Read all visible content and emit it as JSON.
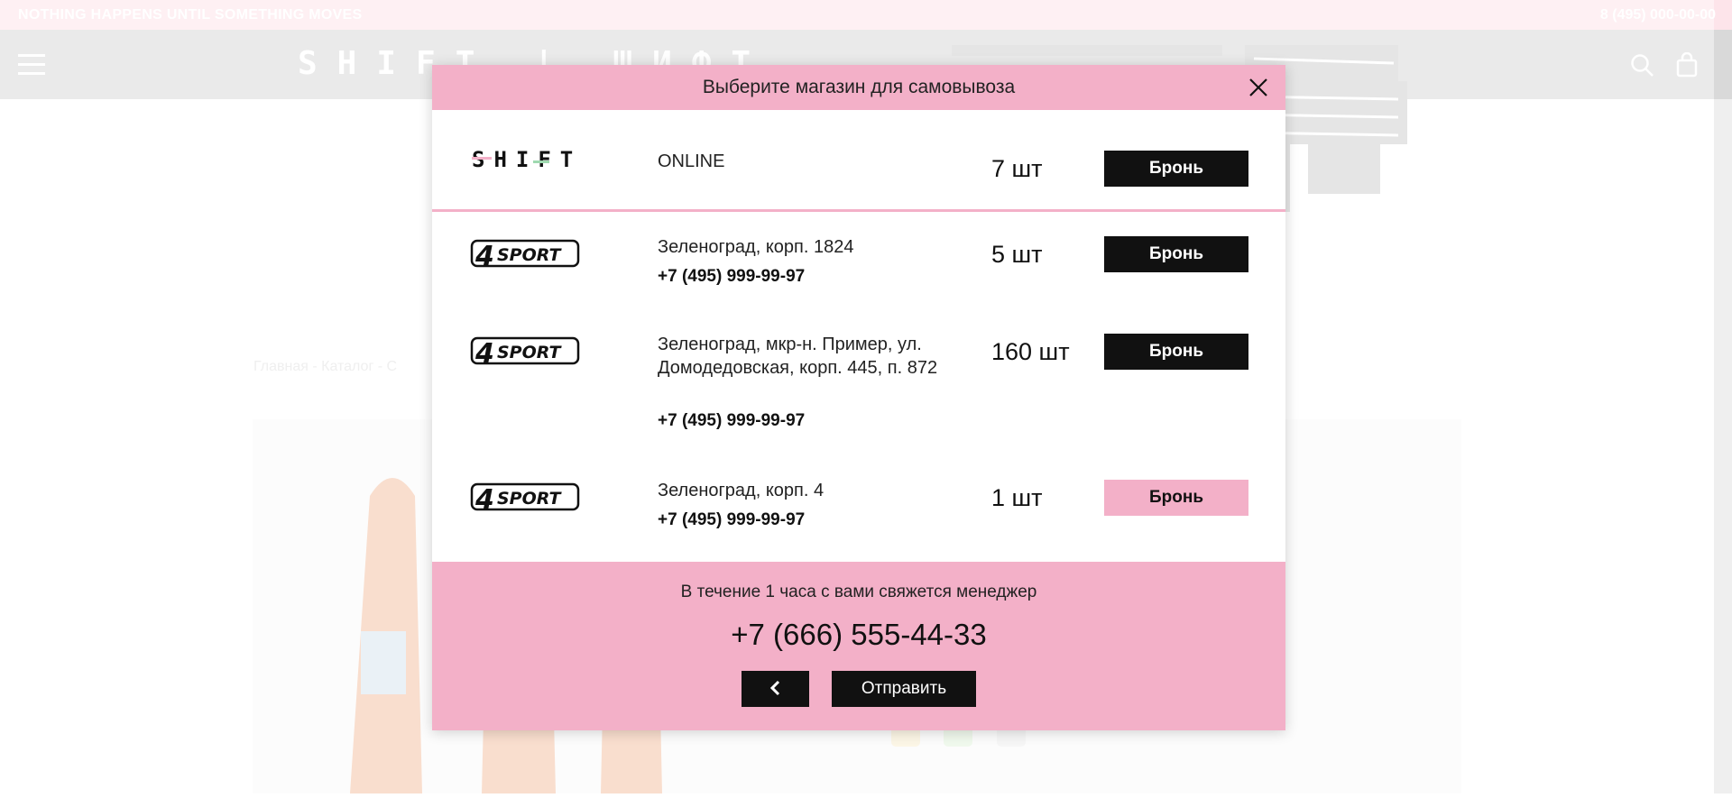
{
  "ticker": {
    "text": "NOTHING HAPPENS UNTIL SOMETHING MOVES",
    "right_text": "8 (495) 000-00-00"
  },
  "site": {
    "logo_text": "SHIFT | ШИФТ"
  },
  "breadcrumb": "Главная - Каталог - С",
  "modal": {
    "title": "Выберите магазин для самовывоза",
    "stores": [
      {
        "brand": "SHIFT",
        "address": "ONLINE",
        "phone": "",
        "qty": "7 шт",
        "button": "Бронь"
      },
      {
        "brand": "4SPORT",
        "address": "Зеленоград, корп. 1824",
        "phone": "+7 (495) 999-99-97",
        "qty": "5 шт",
        "button": "Бронь"
      },
      {
        "brand": "4SPORT",
        "address": "Зеленоград, мкр-н. Пример, ул. Домодедовская, корп. 445, п. 872",
        "phone": "+7 (495) 999-99-97",
        "qty": "160 шт",
        "button": "Бронь"
      },
      {
        "brand": "4SPORT",
        "address": "Зеленоград, корп. 4",
        "phone": "+7 (495) 999-99-97",
        "qty": "1 шт",
        "button": "Бронь",
        "selected": true
      }
    ],
    "footer": {
      "note": "В течение 1 часа с вами свяжется менеджер",
      "phone": "+7 (666) 555-44-33",
      "send_label": "Отправить"
    }
  },
  "colors": {
    "accent_pink": "#f3b0c8",
    "dark": "#111111"
  },
  "icons": [
    "menu-icon",
    "search-icon",
    "bag-icon",
    "close-icon",
    "chevron-left-icon"
  ]
}
